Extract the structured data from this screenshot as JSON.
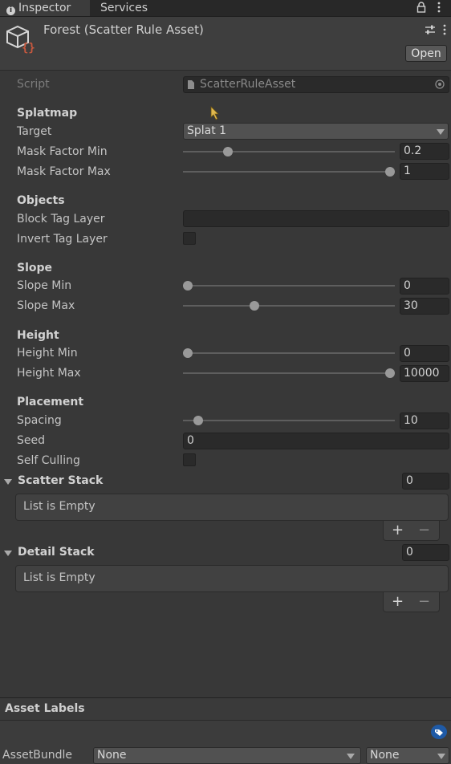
{
  "tabs": {
    "inspector": "Inspector",
    "services": "Services"
  },
  "header": {
    "title": "Forest (Scatter Rule Asset)",
    "open_label": "Open"
  },
  "script_row": {
    "label": "Script",
    "value": "ScatterRuleAsset"
  },
  "splatmap": {
    "title": "Splatmap",
    "target_label": "Target",
    "target_value": "Splat 1",
    "mask_min_label": "Mask Factor Min",
    "mask_min_value": "0.2",
    "mask_min_fraction": 0.2,
    "mask_max_label": "Mask Factor Max",
    "mask_max_value": "1",
    "mask_max_fraction": 1.0
  },
  "objects": {
    "title": "Objects",
    "block_tag_label": "Block Tag Layer",
    "block_tag_value": "",
    "invert_tag_label": "Invert Tag Layer",
    "invert_checked": false
  },
  "slope": {
    "title": "Slope",
    "min_label": "Slope Min",
    "min_value": "0",
    "min_fraction": 0.0,
    "max_label": "Slope Max",
    "max_value": "30",
    "max_fraction": 0.33
  },
  "height": {
    "title": "Height",
    "min_label": "Height Min",
    "min_value": "0",
    "min_fraction": 0.0,
    "max_label": "Height Max",
    "max_value": "10000",
    "max_fraction": 1.0
  },
  "placement": {
    "title": "Placement",
    "spacing_label": "Spacing",
    "spacing_value": "10",
    "spacing_fraction": 0.05,
    "seed_label": "Seed",
    "seed_value": "0",
    "self_culling_label": "Self Culling",
    "self_culling_checked": false
  },
  "scatter_stack": {
    "title": "Scatter Stack",
    "count": "0",
    "empty_text": "List is Empty"
  },
  "detail_stack": {
    "title": "Detail Stack",
    "count": "0",
    "empty_text": "List is Empty"
  },
  "footer": {
    "asset_labels": "Asset Labels",
    "assetbundle_label": "AssetBundle",
    "bundle_value": "None",
    "variant_value": "None"
  },
  "icons": {
    "lock": "lock-icon",
    "menu": "kebab-menu-icon",
    "asset": "scriptable-object-icon",
    "settings": "sliders-icon",
    "script": "script-file-icon",
    "picker": "object-picker-icon",
    "tag": "tag-icon"
  },
  "colors": {
    "background": "#383838",
    "field": "#2a2a2a",
    "accent_tag": "#1f5aa6",
    "asset_braces": "#c7583e"
  }
}
